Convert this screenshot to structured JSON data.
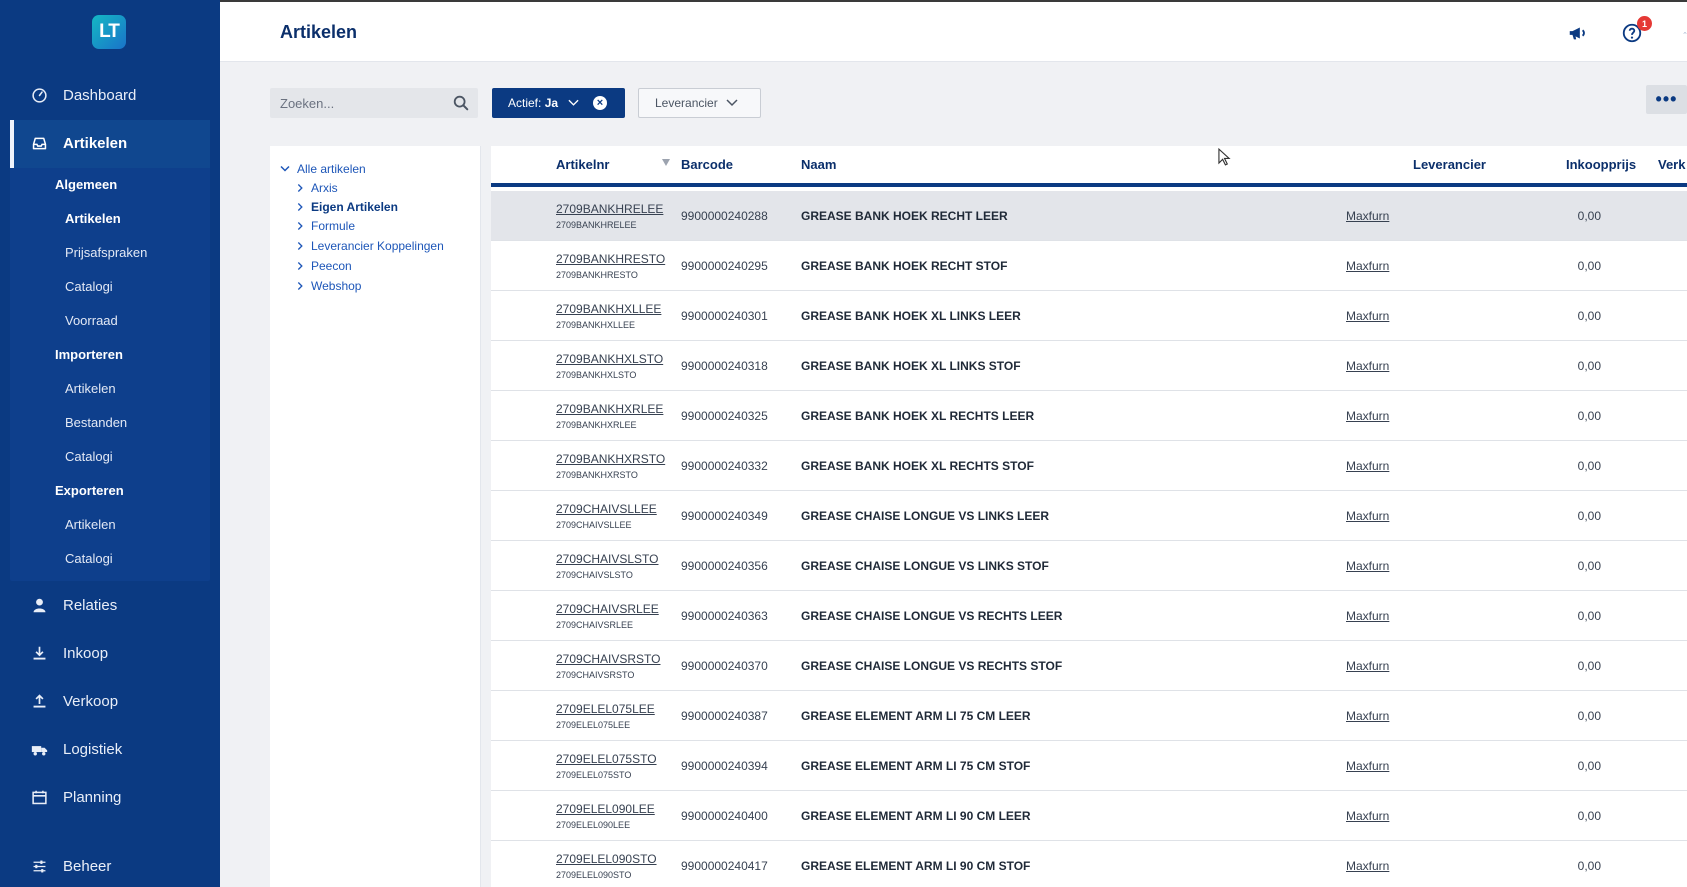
{
  "app": {
    "logo_text": "LT",
    "page_title": "Artikelen"
  },
  "sidebar": {
    "items": [
      {
        "label": "Dashboard",
        "icon": "dashboard-icon"
      },
      {
        "label": "Artikelen",
        "icon": "inbox-icon"
      },
      {
        "label": "Relaties",
        "icon": "user-icon"
      },
      {
        "label": "Inkoop",
        "icon": "download-icon"
      },
      {
        "label": "Verkoop",
        "icon": "upload-icon"
      },
      {
        "label": "Logistiek",
        "icon": "truck-icon"
      },
      {
        "label": "Planning",
        "icon": "calendar-icon"
      },
      {
        "label": "Beheer",
        "icon": "sliders-icon"
      }
    ],
    "sub": {
      "algemeen": "Algemeen",
      "algemeen_items": [
        "Artikelen",
        "Prijsafspraken",
        "Catalogi",
        "Voorraad"
      ],
      "importeren": "Importeren",
      "importeren_items": [
        "Artikelen",
        "Bestanden",
        "Catalogi"
      ],
      "exporteren": "Exporteren",
      "exporteren_items": [
        "Artikelen",
        "Catalogi"
      ]
    }
  },
  "topbar": {
    "notification_count": "1"
  },
  "toolbar": {
    "search_placeholder": "Zoeken...",
    "filter_active_label": "Actief:",
    "filter_active_value": "Ja",
    "filter_leverancier": "Leverancier",
    "more_label": "•••"
  },
  "tree": {
    "root": "Alle artikelen",
    "items": [
      "Arxis",
      "Eigen Artikelen",
      "Formule",
      "Leverancier Koppelingen",
      "Peecon",
      "Webshop"
    ]
  },
  "table": {
    "headers": {
      "artikelnr": "Artikelnr",
      "barcode": "Barcode",
      "naam": "Naam",
      "leverancier": "Leverancier",
      "inkoopprijs": "Inkoopprijs",
      "verk": "Verk"
    },
    "rows": [
      {
        "art": "2709BANKHRELEE",
        "art2": "2709BANKHRELEE",
        "barcode": "9900000240288",
        "naam": "GREASE BANK HOEK RECHT LEER",
        "lev": "Maxfurn",
        "prijs": "0,00"
      },
      {
        "art": "2709BANKHRESTO",
        "art2": "2709BANKHRESTO",
        "barcode": "9900000240295",
        "naam": "GREASE BANK HOEK RECHT STOF",
        "lev": "Maxfurn",
        "prijs": "0,00"
      },
      {
        "art": "2709BANKHXLLEE",
        "art2": "2709BANKHXLLEE",
        "barcode": "9900000240301",
        "naam": "GREASE BANK HOEK XL LINKS LEER",
        "lev": "Maxfurn",
        "prijs": "0,00"
      },
      {
        "art": "2709BANKHXLSTO",
        "art2": "2709BANKHXLSTO",
        "barcode": "9900000240318",
        "naam": "GREASE BANK HOEK XL LINKS STOF",
        "lev": "Maxfurn",
        "prijs": "0,00"
      },
      {
        "art": "2709BANKHXRLEE",
        "art2": "2709BANKHXRLEE",
        "barcode": "9900000240325",
        "naam": "GREASE BANK HOEK XL RECHTS LEER",
        "lev": "Maxfurn",
        "prijs": "0,00"
      },
      {
        "art": "2709BANKHXRSTO",
        "art2": "2709BANKHXRSTO",
        "barcode": "9900000240332",
        "naam": "GREASE BANK HOEK XL RECHTS STOF",
        "lev": "Maxfurn",
        "prijs": "0,00"
      },
      {
        "art": "2709CHAIVSLLEE",
        "art2": "2709CHAIVSLLEE",
        "barcode": "9900000240349",
        "naam": "GREASE CHAISE LONGUE VS LINKS LEER",
        "lev": "Maxfurn",
        "prijs": "0,00"
      },
      {
        "art": "2709CHAIVSLSTO",
        "art2": "2709CHAIVSLSTO",
        "barcode": "9900000240356",
        "naam": "GREASE CHAISE LONGUE VS LINKS STOF",
        "lev": "Maxfurn",
        "prijs": "0,00"
      },
      {
        "art": "2709CHAIVSRLEE",
        "art2": "2709CHAIVSRLEE",
        "barcode": "9900000240363",
        "naam": "GREASE CHAISE LONGUE VS RECHTS LEER",
        "lev": "Maxfurn",
        "prijs": "0,00"
      },
      {
        "art": "2709CHAIVSRSTO",
        "art2": "2709CHAIVSRSTO",
        "barcode": "9900000240370",
        "naam": "GREASE CHAISE LONGUE VS RECHTS STOF",
        "lev": "Maxfurn",
        "prijs": "0,00"
      },
      {
        "art": "2709ELEL075LEE",
        "art2": "2709ELEL075LEE",
        "barcode": "9900000240387",
        "naam": "GREASE ELEMENT ARM LI 75 CM LEER",
        "lev": "Maxfurn",
        "prijs": "0,00"
      },
      {
        "art": "2709ELEL075STO",
        "art2": "2709ELEL075STO",
        "barcode": "9900000240394",
        "naam": "GREASE ELEMENT ARM LI 75 CM STOF",
        "lev": "Maxfurn",
        "prijs": "0,00"
      },
      {
        "art": "2709ELEL090LEE",
        "art2": "2709ELEL090LEE",
        "barcode": "9900000240400",
        "naam": "GREASE ELEMENT ARM LI 90 CM LEER",
        "lev": "Maxfurn",
        "prijs": "0,00"
      },
      {
        "art": "2709ELEL090STO",
        "art2": "2709ELEL090STO",
        "barcode": "9900000240417",
        "naam": "GREASE ELEMENT ARM LI 90 CM STOF",
        "lev": "Maxfurn",
        "prijs": "0,00"
      }
    ]
  }
}
